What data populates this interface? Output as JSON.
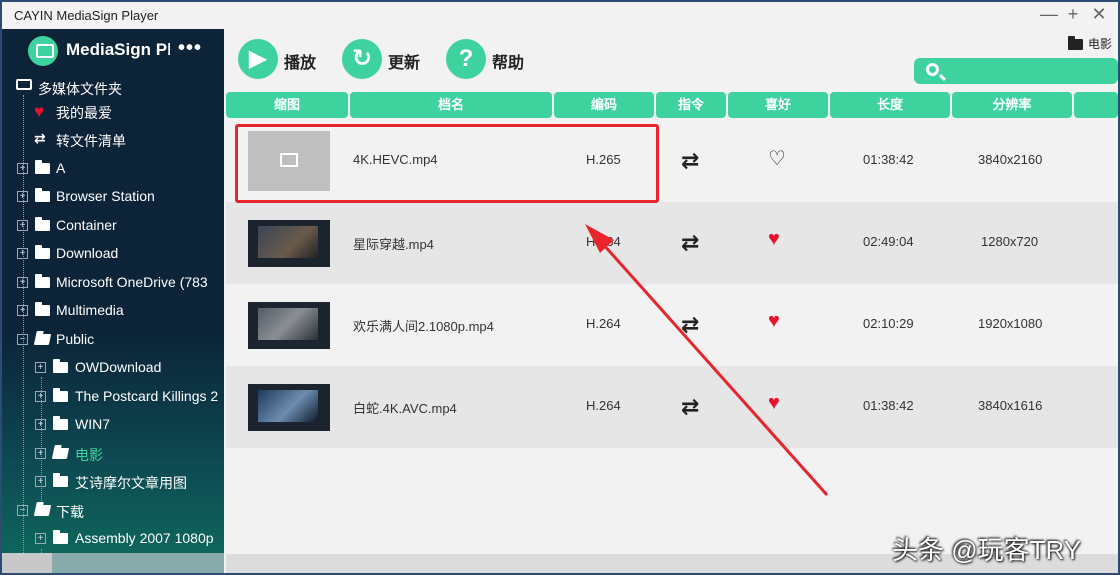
{
  "window": {
    "title": "CAYIN MediaSign Player",
    "controls": [
      "—",
      "+",
      "✕"
    ]
  },
  "brand": {
    "name": "MediaSign Player",
    "more": "•••"
  },
  "tree": [
    {
      "label": "多媒体文件夹",
      "icon": "hdd-icon"
    },
    {
      "label": "我的最爱",
      "icon": "heart-icon"
    },
    {
      "label": "转文件清单",
      "icon": "swap-icon"
    },
    {
      "label": "A",
      "icon": "folder-icon"
    },
    {
      "label": "Browser Station",
      "icon": "folder-icon"
    },
    {
      "label": "Container",
      "icon": "folder-icon"
    },
    {
      "label": "Download",
      "icon": "folder-icon"
    },
    {
      "label": "Microsoft OneDrive (783",
      "icon": "folder-icon"
    },
    {
      "label": "Multimedia",
      "icon": "folder-icon"
    },
    {
      "label": "Public",
      "icon": "folder-open-icon"
    },
    {
      "label": "OWDownload",
      "icon": "folder-icon"
    },
    {
      "label": "The Postcard Killings 2",
      "icon": "folder-icon"
    },
    {
      "label": "WIN7",
      "icon": "folder-icon"
    },
    {
      "label": "电影",
      "icon": "folder-open-icon",
      "active": true
    },
    {
      "label": "艾诗摩尔文章用图",
      "icon": "folder-icon"
    },
    {
      "label": "下载",
      "icon": "folder-open-icon"
    },
    {
      "label": "Assembly 2007 1080p",
      "icon": "folder-icon"
    }
  ],
  "toolbar": {
    "play": "播放",
    "refresh": "更新",
    "help": "帮助",
    "breadcrumb": "电影"
  },
  "table": {
    "headers": [
      "缩图",
      "档名",
      "编码",
      "指令",
      "喜好",
      "长度",
      "分辨率"
    ],
    "rows": [
      {
        "name": "4K.HEVC.mp4",
        "codec": "H.265",
        "favorite": false,
        "length": "01:38:42",
        "resolution": "3840x2160"
      },
      {
        "name": "星际穿越.mp4",
        "codec": "H.264",
        "favorite": true,
        "length": "02:49:04",
        "resolution": "1280x720"
      },
      {
        "name": "欢乐满人间2.1080p.mp4",
        "codec": "H.264",
        "favorite": true,
        "length": "02:10:29",
        "resolution": "1920x1080"
      },
      {
        "name": "白蛇.4K.AVC.mp4",
        "codec": "H.264",
        "favorite": true,
        "length": "01:38:42",
        "resolution": "3840x1616"
      }
    ]
  },
  "watermark": "头条 @玩客TRY",
  "colors": {
    "accent": "#3ed39e",
    "sidebar": "#0c2338",
    "highlight": "#e8242d",
    "heart": "#e8112d"
  }
}
